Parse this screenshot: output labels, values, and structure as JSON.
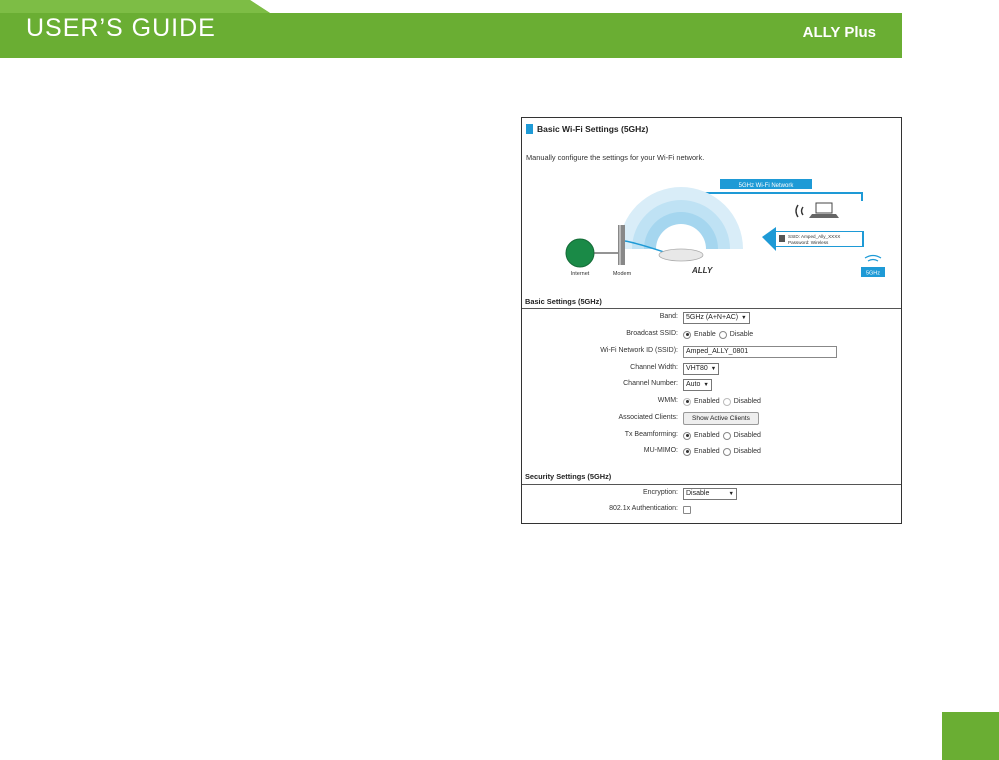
{
  "header": {
    "title": "USER’S GUIDE",
    "product": "ALLY Plus"
  },
  "panel": {
    "title": "Basic Wi-Fi Settings (5GHz)",
    "description": "Manually configure the settings for your Wi-Fi network.",
    "diagram": {
      "network_label": "5GHz Wi-Fi Network",
      "internet_label": "Internet",
      "modem_label": "Modem",
      "brand": "ALLY",
      "ssid_text": "SSID: Amped_Ally_XXXX",
      "password_text": "Password: Wireless",
      "band_badge": "5GHz"
    },
    "basic_section": {
      "heading": "Basic Settings (5GHz)",
      "band": {
        "label": "Band:",
        "value": "5GHz (A+N+AC)"
      },
      "broadcast_ssid": {
        "label": "Broadcast SSID:",
        "option_enable": "Enable",
        "option_disable": "Disable"
      },
      "ssid": {
        "label": "Wi-Fi Network ID (SSID):",
        "value": "Amped_ALLY_0801"
      },
      "channel_width": {
        "label": "Channel Width:",
        "value": "VHT80"
      },
      "channel_number": {
        "label": "Channel Number:",
        "value": "Auto"
      },
      "wmm": {
        "label": "WMM:",
        "option_enabled": "Enabled",
        "option_disabled": "Disabled"
      },
      "clients": {
        "label": "Associated Clients:",
        "button": "Show Active Clients"
      },
      "beamforming": {
        "label": "Tx Beamforming:",
        "option_enabled": "Enabled",
        "option_disabled": "Disabled"
      },
      "mumimo": {
        "label": "MU-MIMO:",
        "option_enabled": "Enabled",
        "option_disabled": "Disabled"
      }
    },
    "security_section": {
      "heading": "Security Settings (5GHz)",
      "encryption": {
        "label": "Encryption:",
        "value": "Disable"
      },
      "auth": {
        "label": "802.1x Authentication:"
      }
    }
  },
  "colors": {
    "brand_green": "#6aae33",
    "accent_blue": "#1e9ad6"
  }
}
